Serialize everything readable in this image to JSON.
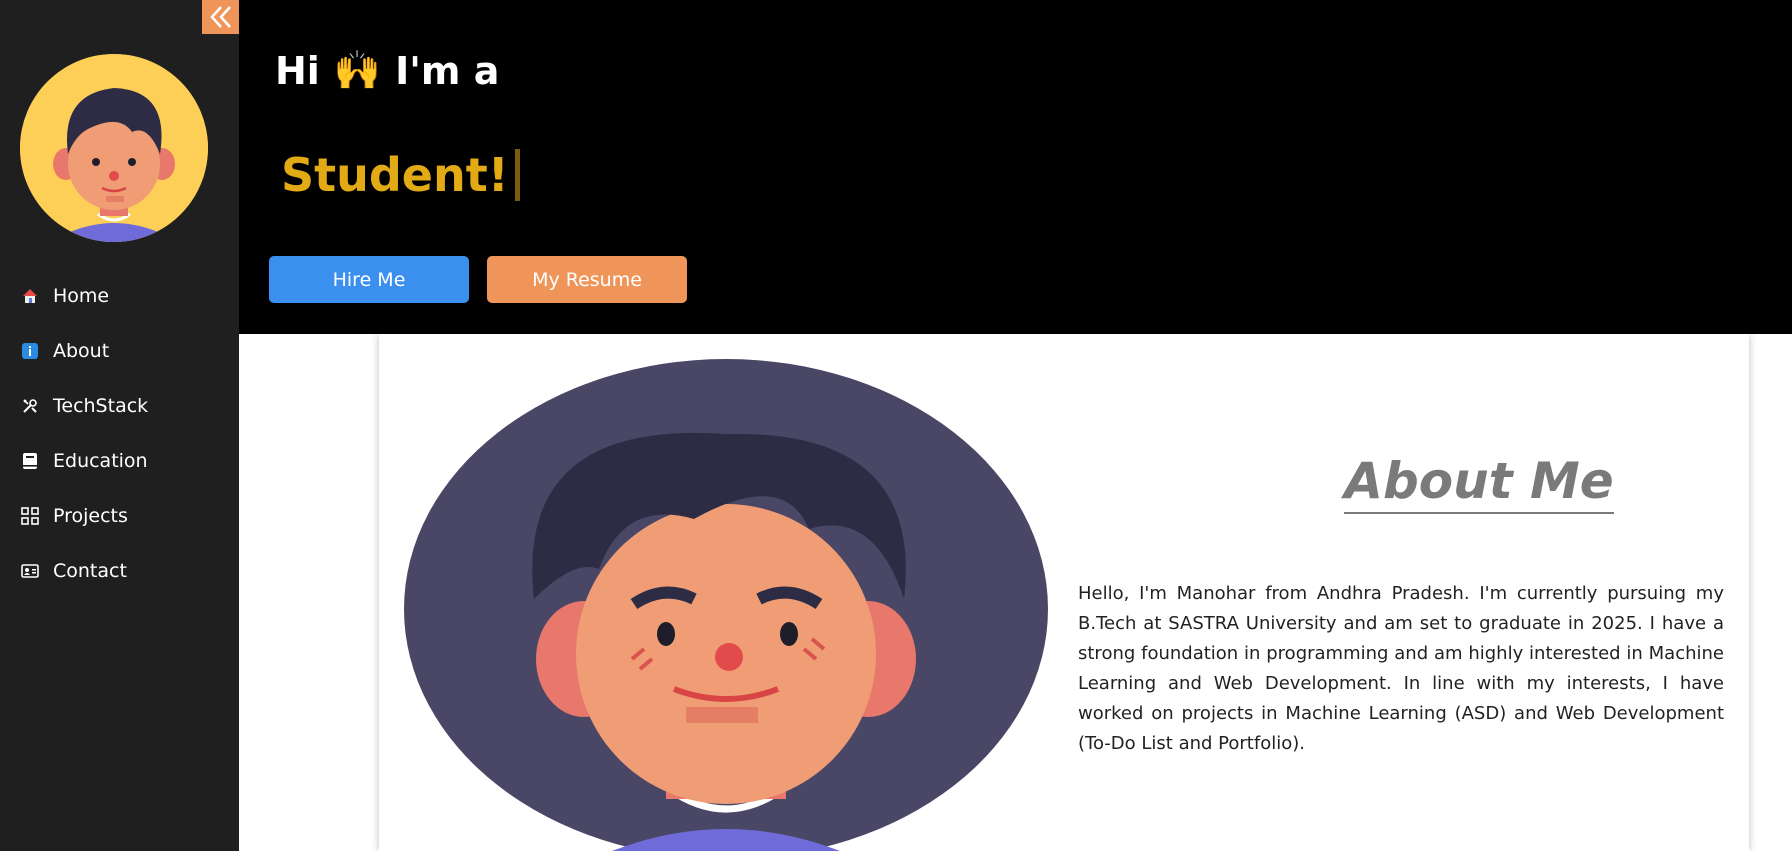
{
  "sidebar": {
    "collapse_icon": "double-chevron-left-icon",
    "avatar_icon": "boy-avatar-icon",
    "items": [
      {
        "label": "Home",
        "icon": "house-icon"
      },
      {
        "label": "About",
        "icon": "info-icon"
      },
      {
        "label": "TechStack",
        "icon": "tools-icon"
      },
      {
        "label": "Education",
        "icon": "book-icon"
      },
      {
        "label": "Projects",
        "icon": "grid-icon"
      },
      {
        "label": "Contact",
        "icon": "contact-card-icon"
      }
    ]
  },
  "hero": {
    "greeting_hi": "Hi",
    "greeting_emoji": "🙌",
    "greeting_rest": "I'm a",
    "role_text": "Student!",
    "hire_label": "Hire Me",
    "resume_label": "My Resume"
  },
  "about": {
    "title": "About Me",
    "paragraph": "Hello, I'm Manohar from Andhra Pradesh. I'm currently pursuing my B.Tech at SASTRA University and am set to graduate in 2025. I have a strong foundation in programming and am highly interested in Machine Learning and Web Development. In line with my interests, I have worked on projects in Machine Learning (ASD) and Web Development (To-Do List and Portfolio)."
  },
  "colors": {
    "sidebar_bg": "#1f1f1f",
    "hero_bg": "#000000",
    "accent_orange": "#f0955a",
    "accent_blue": "#3b8fef",
    "role_gold": "#e2aa14"
  }
}
